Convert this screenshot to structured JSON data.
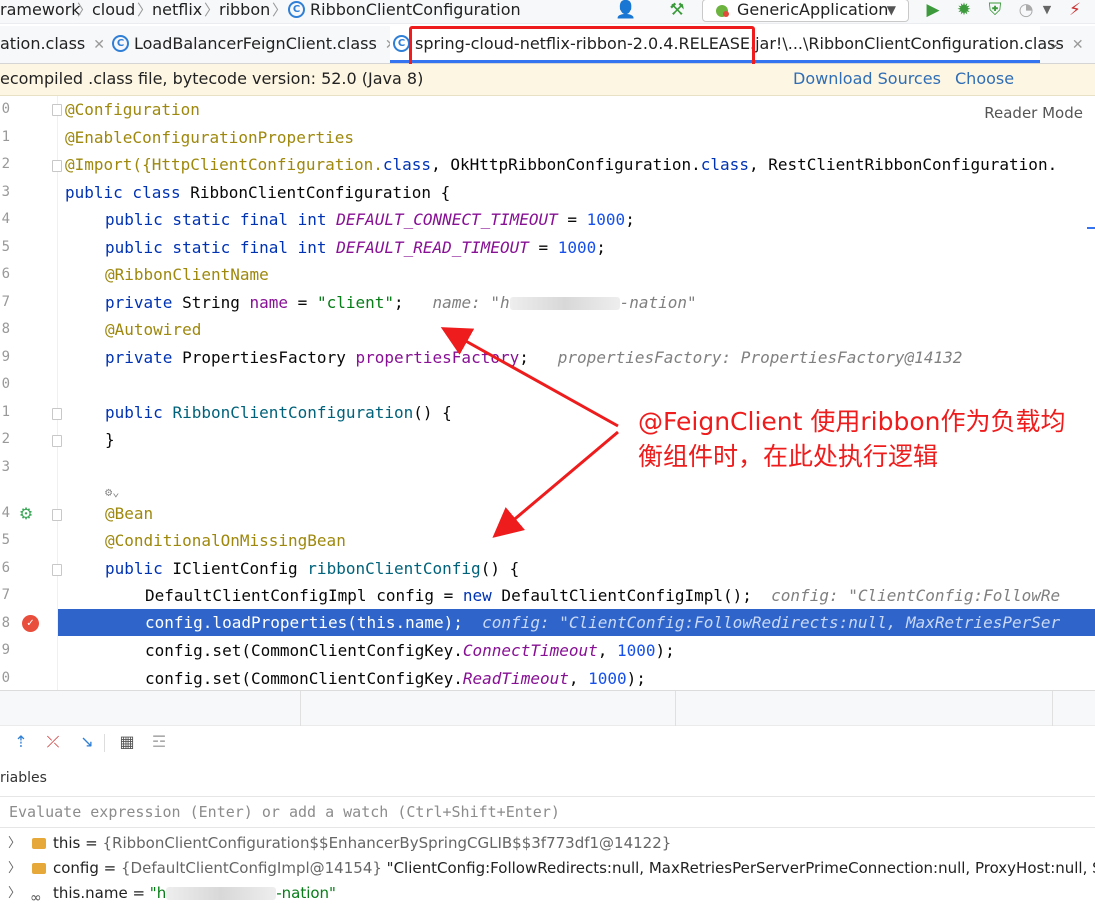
{
  "breadcrumb": [
    "ramework",
    "cloud",
    "netflix",
    "ribbon",
    "RibbonClientConfiguration"
  ],
  "run_config": "GenericApplication",
  "tabs": [
    {
      "label": "ation.class"
    },
    {
      "label": "LoadBalancerFeignClient.class"
    },
    {
      "label": "spring-cloud-netflix-ribbon-2.0.4.RELEASE.jar!\\...\\RibbonClientConfiguration.class"
    }
  ],
  "banner": {
    "info": "ecompiled .class file, bytecode version: 52.0 (Java 8)",
    "download_sources": "Download Sources",
    "choose_sources": "Choose Sources..."
  },
  "editor": {
    "reader_mode": "Reader Mode",
    "line_numbers": [
      "0",
      "1",
      "2",
      "3",
      "4",
      "5",
      "6",
      "7",
      "8",
      "9",
      "0",
      "1",
      "2",
      "3",
      "",
      "4",
      "5",
      "6",
      "7",
      "8",
      "9",
      "0"
    ],
    "code": {
      "l0": "@Configuration",
      "l1": "@EnableConfigurationProperties",
      "l2a": "@Import({HttpClientConfiguration.",
      "l2b": "class",
      "l2c": ", OkHttpRibbonConfiguration.",
      "l2d": "class",
      "l2e": ", RestClientRibbonConfiguration.",
      "l3a": "public class",
      "l3b": " RibbonClientConfiguration {",
      "l4a": "public static final int ",
      "l4b": "DEFAULT_CONNECT_TIMEOUT",
      "l4c": " = ",
      "l4d": "1000",
      "l4e": ";",
      "l5a": "public static final int ",
      "l5b": "DEFAULT_READ_TIMEOUT",
      "l5c": " = ",
      "l5d": "1000",
      "l5e": ";",
      "l6": "@RibbonClientName",
      "l7a": "private",
      "l7b": " String ",
      "l7c": "name",
      "l7d": " = ",
      "l7e": "\"client\"",
      "l7f": ";",
      "l7hint_a": "name: \"h",
      "l7hint_b": "-nation\"",
      "l8": "@Autowired",
      "l9a": "private",
      "l9b": " PropertiesFactory ",
      "l9c": "propertiesFactory",
      "l9d": ";",
      "l9hint": "propertiesFactory: PropertiesFactory@14132",
      "l11a": "public ",
      "l11b": "RibbonClientConfiguration",
      "l11c": "() {",
      "l12": "}",
      "l14": "@Bean",
      "l15": "@ConditionalOnMissingBean",
      "l16a": "public",
      "l16b": " IClientConfig ",
      "l16c": "ribbonClientConfig",
      "l16d": "() {",
      "l17a": "DefaultClientConfigImpl config = ",
      "l17b": "new",
      "l17c": " DefaultClientConfigImpl();",
      "l17hint": "config: \"ClientConfig:FollowRe",
      "l18": "config.loadProperties(this.name);",
      "l18hint": "config: \"ClientConfig:FollowRedirects:null, MaxRetriesPerSer",
      "l19a": "config.set(CommonClientConfigKey.",
      "l19b": "ConnectTimeout",
      "l19c": ", ",
      "l19d": "1000",
      "l19e": ");",
      "l20a": "config.set(CommonClientConfigKey.",
      "l20b": "ReadTimeout",
      "l20c": ", ",
      "l20d": "1000",
      "l20e": ");"
    },
    "callout": "@FeignClient 使用ribbon作为负载均衡组件时，在此处执行逻辑"
  },
  "debugger": {
    "variables_title": "riables",
    "eval_placeholder": "Evaluate expression (Enter) or add a watch (Ctrl+Shift+Enter)",
    "vars": [
      {
        "name": "this",
        "eq": " = ",
        "value": "{RibbonClientConfiguration$$EnhancerBySpringCGLIB$$3f773df1@14122}",
        "extra": ""
      },
      {
        "name": "config",
        "eq": " = ",
        "value": "{DefaultClientConfigImpl@14154}",
        "extra": " \"ClientConfig:FollowRedirects:null, MaxRetriesPerServerPrimeConnection:null, ProxyHost:null, Secur"
      },
      {
        "name": "this.name",
        "eq": " = ",
        "value": "\"h",
        "extra": "-nation\""
      }
    ]
  },
  "colors": {
    "accent": "#3574f0",
    "exec_line": "#2f65ca",
    "annotation_red": "#ee1c1c"
  }
}
